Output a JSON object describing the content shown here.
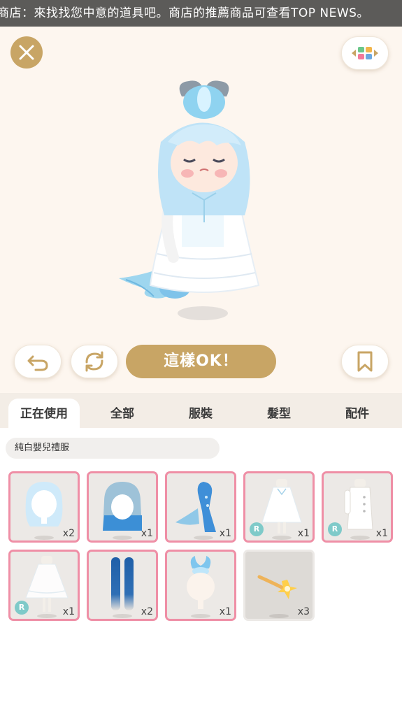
{
  "ticker": {
    "text": "商店：來找找您中意的道具吧。商店的推薦商品可查看TOP NEWS。"
  },
  "toolbar": {
    "confirm_label": "這樣OK！"
  },
  "tabs": [
    {
      "label": "正在使用",
      "active": true
    },
    {
      "label": "全部",
      "active": false
    },
    {
      "label": "服裝",
      "active": false
    },
    {
      "label": "髮型",
      "active": false
    },
    {
      "label": "配件",
      "active": false
    }
  ],
  "current_set": {
    "name": "純白嬰兒禮服"
  },
  "items": [
    {
      "icon": "light-blue-hair",
      "qty": "x2",
      "rare": false
    },
    {
      "icon": "blue-gradient-hair",
      "qty": "x1",
      "rare": false
    },
    {
      "icon": "blue-mermaid-tail",
      "qty": "x1",
      "rare": false
    },
    {
      "icon": "white-sheer-dress",
      "qty": "x1",
      "rare": true,
      "rare_label": "R"
    },
    {
      "icon": "white-coat",
      "qty": "x1",
      "rare": true,
      "rare_label": "R"
    },
    {
      "icon": "white-sheer-gown",
      "qty": "x1",
      "rare": true,
      "rare_label": "R"
    },
    {
      "icon": "blue-stockings",
      "qty": "x2",
      "rare": false
    },
    {
      "icon": "blue-flame-hair-ornament",
      "qty": "x1",
      "rare": false
    },
    {
      "icon": "golden-sparkle-effect",
      "qty": "x3",
      "rare": false
    }
  ],
  "colors": {
    "gold": "#c8a565",
    "pink_border": "#ef8fa6",
    "rare_badge": "#7fcac9",
    "stage_bg": "#fdf6ef"
  }
}
